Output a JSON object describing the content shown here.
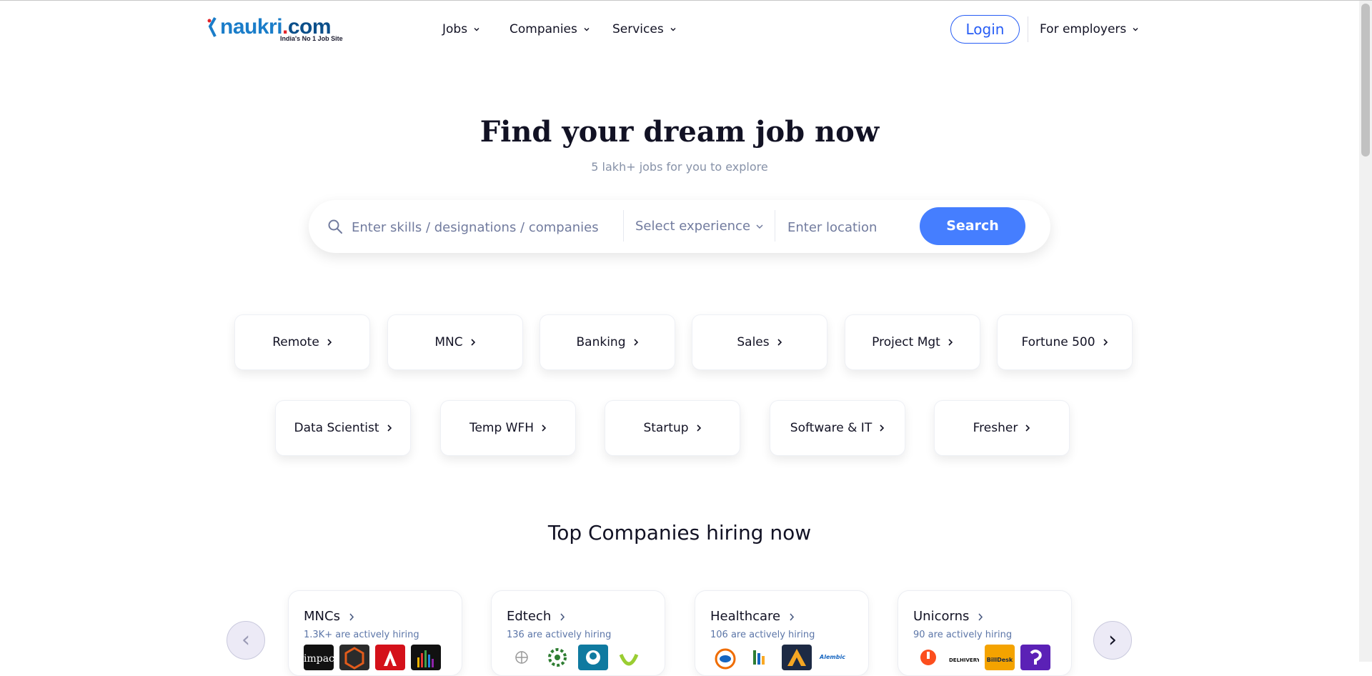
{
  "header": {
    "logo_text": "naukri",
    "logo_dot": ".",
    "logo_com": "com",
    "logo_tagline": "India's No 1 Job Site",
    "nav": [
      {
        "label": "Jobs"
      },
      {
        "label": "Companies"
      },
      {
        "label": "Services"
      }
    ],
    "login_label": "Login",
    "employers_label": "For employers"
  },
  "hero": {
    "title": "Find your dream job now",
    "subtitle": "5 lakh+ jobs for you to explore"
  },
  "search": {
    "skills_placeholder": "Enter skills / designations / companies",
    "experience_placeholder": "Select experience",
    "location_placeholder": "Enter location",
    "button_label": "Search"
  },
  "categories": {
    "row1": [
      "Remote",
      "MNC",
      "Banking",
      "Sales",
      "Project Mgt",
      "Fortune 500"
    ],
    "row2": [
      "Data Scientist",
      "Temp WFH",
      "Startup",
      "Software & IT",
      "Fresher"
    ]
  },
  "companies": {
    "title": "Top Companies hiring now",
    "prev_label": "‹",
    "next_label": "›",
    "cards": [
      {
        "name": "MNCs",
        "count": "1.3K+ are actively hiring",
        "logo_text": [
          "impac",
          "",
          "",
          ""
        ]
      },
      {
        "name": "Edtech",
        "count": "136 are actively hiring",
        "logo_text": [
          "",
          "",
          "",
          ""
        ]
      },
      {
        "name": "Healthcare",
        "count": "106 are actively hiring",
        "logo_text": [
          "",
          "",
          "",
          "Alembic"
        ]
      },
      {
        "name": "Unicorns",
        "count": "90 are actively hiring",
        "logo_text": [
          "",
          "DELHIVERY",
          "BillDesk",
          ""
        ]
      }
    ]
  },
  "colors": {
    "brand_blue": "#275df5",
    "search_button": "#457eff",
    "text_dark": "#121224",
    "text_muted": "#8792a8"
  }
}
